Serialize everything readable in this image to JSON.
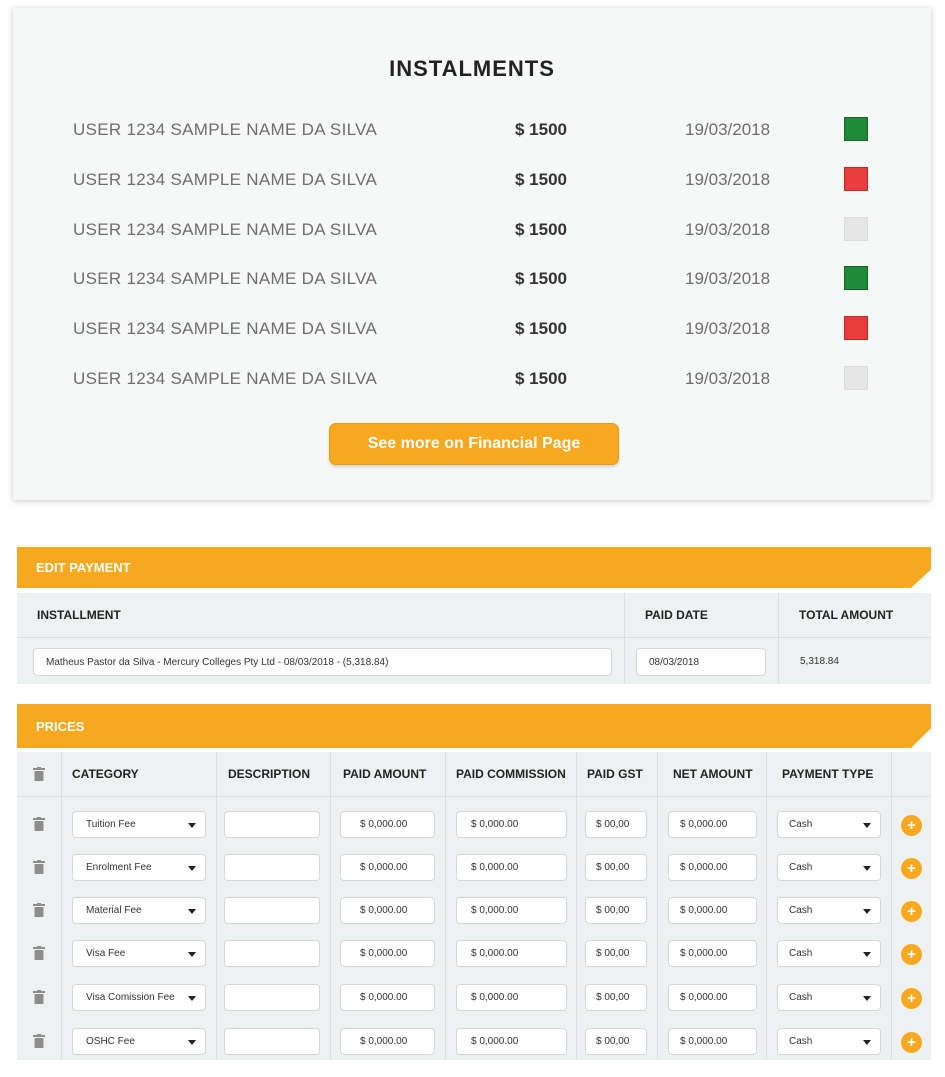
{
  "instalments": {
    "title": "INSTALMENTS",
    "rows": [
      {
        "name": "USER 1234 SAMPLE NAME DA SILVA",
        "amount": "$ 1500",
        "date": "19/03/2018",
        "status": "paid"
      },
      {
        "name": "USER 1234 SAMPLE NAME DA SILVA",
        "amount": "$ 1500",
        "date": "19/03/2018",
        "status": "overdue"
      },
      {
        "name": "USER 1234 SAMPLE NAME DA SILVA",
        "amount": "$ 1500",
        "date": "19/03/2018",
        "status": "pending"
      },
      {
        "name": "USER 1234 SAMPLE NAME DA SILVA",
        "amount": "$ 1500",
        "date": "19/03/2018",
        "status": "paid"
      },
      {
        "name": "USER 1234 SAMPLE NAME DA SILVA",
        "amount": "$ 1500",
        "date": "19/03/2018",
        "status": "overdue"
      },
      {
        "name": "USER 1234 SAMPLE NAME DA SILVA",
        "amount": "$ 1500",
        "date": "19/03/2018",
        "status": "pending"
      }
    ],
    "see_more_label": "See more on Financial Page"
  },
  "colors": {
    "accent": "#f7a81f",
    "status_paid": "#1f8b3a",
    "status_overdue": "#ea3d3d",
    "status_pending": "#e6e6e6"
  },
  "edit_payment": {
    "title": "EDIT PAYMENT",
    "headers": {
      "installment": "INSTALLMENT",
      "paid_date": "PAID DATE",
      "total_amount": "TOTAL AMOUNT"
    },
    "installment_value": "Matheus Pastor da Silva - Mercury Colleges Pty Ltd - 08/03/2018 - (5,318.84)",
    "paid_date_value": "08/03/2018",
    "total_amount_value": "5,318.84"
  },
  "prices": {
    "title": "PRICES",
    "headers": [
      "CATEGORY",
      "DESCRIPTION",
      "PAID AMOUNT",
      "PAID COMMISSION",
      "PAID GST",
      "NET AMOUNT",
      "PAYMENT TYPE"
    ],
    "rows": [
      {
        "category": "Tuition Fee",
        "description": "",
        "paid_amount": "$ 0,000.00",
        "paid_commission": "$ 0,000.00",
        "paid_gst": "$ 00,00",
        "net_amount": "$ 0,000.00",
        "payment_type": "Cash"
      },
      {
        "category": "Enrolment Fee",
        "description": "",
        "paid_amount": "$ 0,000.00",
        "paid_commission": "$ 0,000.00",
        "paid_gst": "$ 00,00",
        "net_amount": "$ 0,000.00",
        "payment_type": "Cash"
      },
      {
        "category": "Material Fee",
        "description": "",
        "paid_amount": "$ 0,000.00",
        "paid_commission": "$ 0,000.00",
        "paid_gst": "$ 00,00",
        "net_amount": "$ 0,000.00",
        "payment_type": "Cash"
      },
      {
        "category": "Visa Fee",
        "description": "",
        "paid_amount": "$ 0,000.00",
        "paid_commission": "$ 0,000.00",
        "paid_gst": "$ 00,00",
        "net_amount": "$ 0,000.00",
        "payment_type": "Cash"
      },
      {
        "category": "Visa Comission Fee",
        "description": "",
        "paid_amount": "$ 0,000.00",
        "paid_commission": "$ 0,000.00",
        "paid_gst": "$ 00,00",
        "net_amount": "$ 0,000.00",
        "payment_type": "Cash"
      },
      {
        "category": "OSHC Fee",
        "description": "",
        "paid_amount": "$ 0,000.00",
        "paid_commission": "$ 0,000.00",
        "paid_gst": "$ 00,00",
        "net_amount": "$ 0,000.00",
        "payment_type": "Cash"
      }
    ],
    "row_icons": {
      "delete": "trash-icon",
      "add": "plus-icon",
      "dropdown": "chevron-down-icon"
    }
  }
}
